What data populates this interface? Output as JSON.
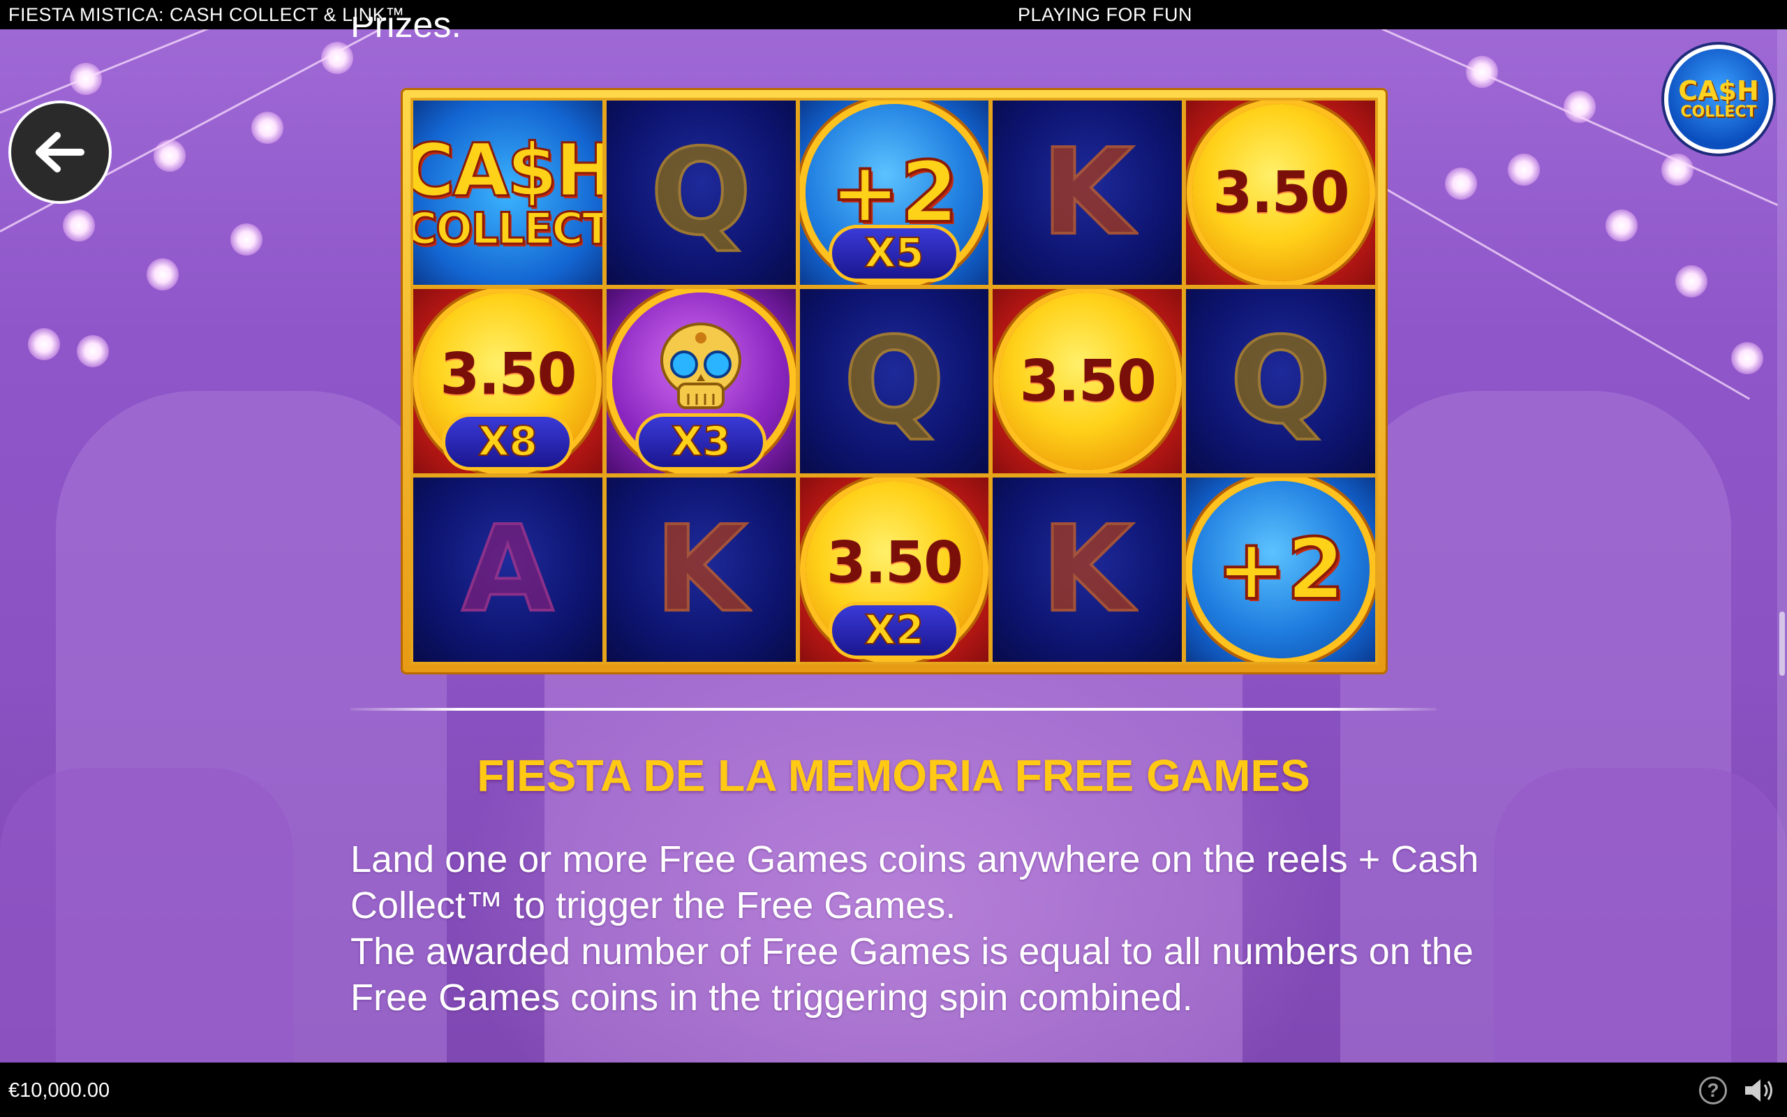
{
  "header": {
    "game_title": "FIESTA MISTICA: CASH COLLECT & LINK™",
    "mode": "PLAYING FOR FUN"
  },
  "logo": {
    "line1": "CA$H",
    "line2": "COLLECT"
  },
  "previous_text_fragment": "Prizes.",
  "reels": {
    "rows": [
      [
        {
          "type": "cash-collect",
          "line1": "CA$H",
          "line2": "COLLECT",
          "bg": "blue"
        },
        {
          "type": "letter",
          "symbol": "Q"
        },
        {
          "type": "plus-coin",
          "value": "+2",
          "multiplier": "X5",
          "bg": "blue"
        },
        {
          "type": "letter",
          "symbol": "K"
        },
        {
          "type": "coin",
          "value": "3.50",
          "bg": "red"
        }
      ],
      [
        {
          "type": "coin",
          "value": "3.50",
          "multiplier": "X8",
          "bg": "red"
        },
        {
          "type": "skull-coin",
          "multiplier": "X3",
          "bg": "purple"
        },
        {
          "type": "letter",
          "symbol": "Q"
        },
        {
          "type": "coin",
          "value": "3.50",
          "bg": "red"
        },
        {
          "type": "letter",
          "symbol": "Q"
        }
      ],
      [
        {
          "type": "letter",
          "symbol": "A"
        },
        {
          "type": "letter",
          "symbol": "K"
        },
        {
          "type": "coin",
          "value": "3.50",
          "multiplier": "X2",
          "bg": "red"
        },
        {
          "type": "letter",
          "symbol": "K"
        },
        {
          "type": "plus-coin",
          "value": "+2",
          "bg": "blue"
        }
      ]
    ]
  },
  "section": {
    "title": "FIESTA DE LA MEMORIA FREE GAMES",
    "paragraph1": "Land one or more Free Games coins anywhere on the reels + Cash Collect™ to trigger the Free Games.",
    "paragraph2": "The awarded number of Free Games is equal to all numbers on the Free Games coins in the triggering spin combined."
  },
  "footer": {
    "balance": "€10,000.00",
    "help_icon": "question-mark-icon",
    "sound_icon": "speaker-icon"
  },
  "colors": {
    "accent_title": "#ffc914",
    "bar_bg": "#000000",
    "background": "#8a4fbf"
  }
}
